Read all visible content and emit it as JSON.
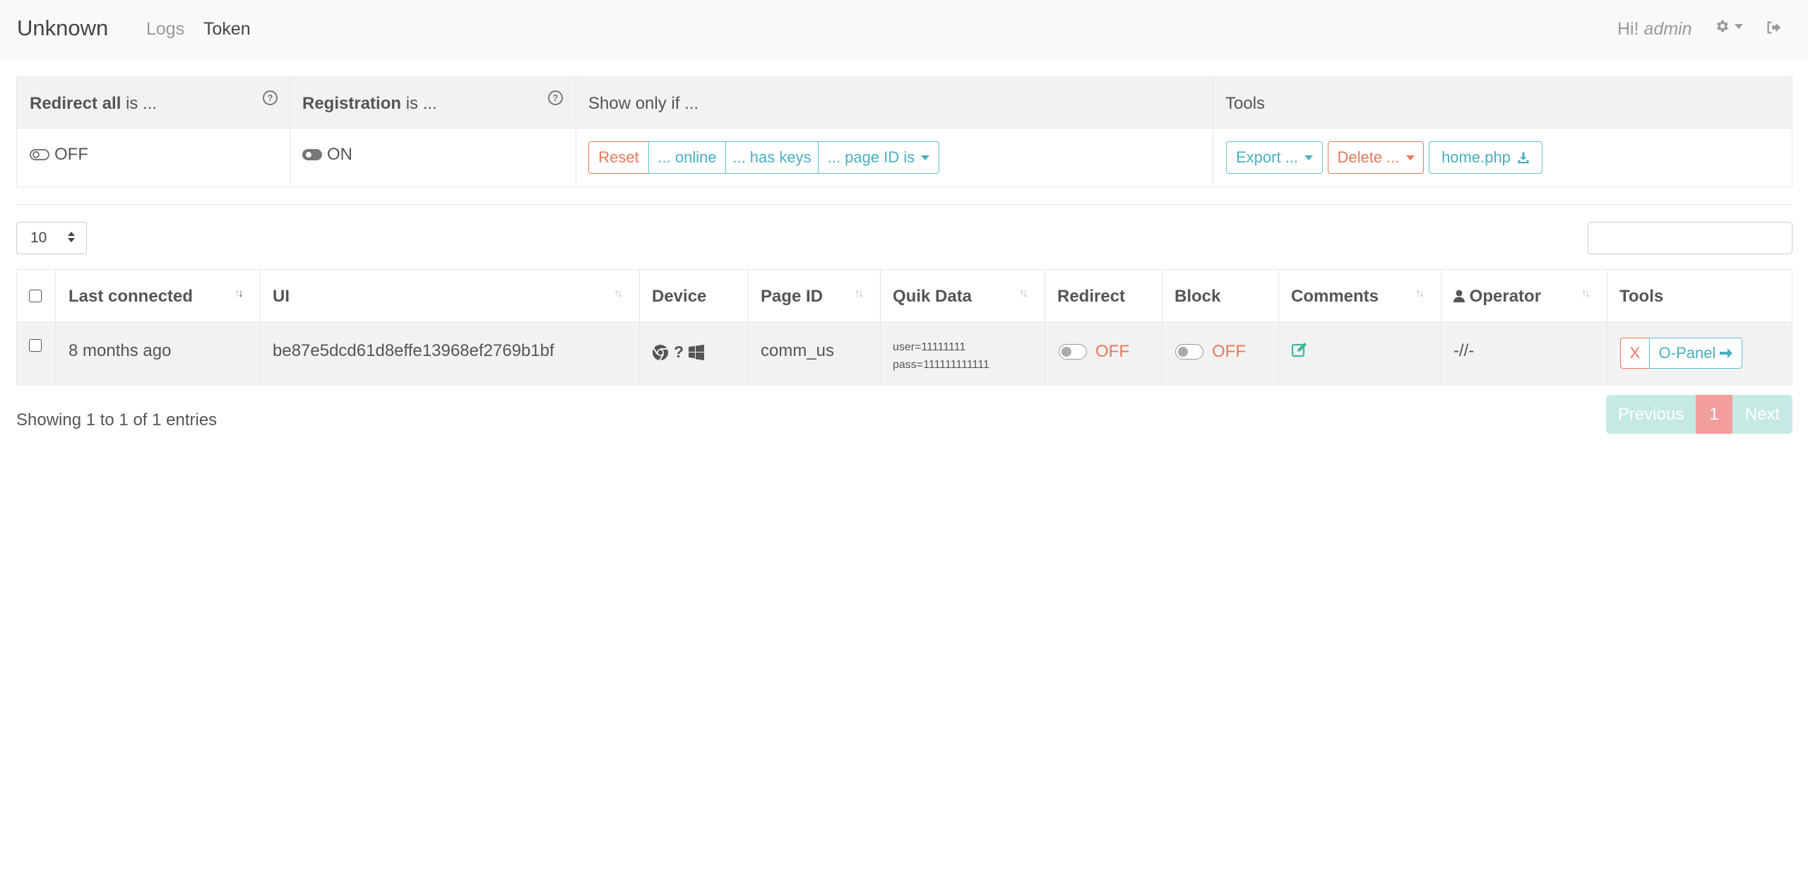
{
  "navbar": {
    "brand": "Unknown",
    "links": [
      "Logs",
      "Token"
    ],
    "greeting_prefix": "Hi!",
    "greeting_user": "admin"
  },
  "controls": {
    "headers": {
      "redirect_all_bold": "Redirect all",
      "redirect_all_rest": "is ...",
      "registration_bold": "Registration",
      "registration_rest": "is ...",
      "show_only": "Show only if ...",
      "tools": "Tools"
    },
    "redirect_all_state": "OFF",
    "registration_state": "ON",
    "filters": {
      "reset": "Reset",
      "online": "... online",
      "has_keys": "... has keys",
      "page_id": "... page ID is"
    },
    "tools": {
      "export": "Export ...",
      "delete": "Delete ...",
      "home": "home.php"
    }
  },
  "table": {
    "page_length": "10",
    "columns": {
      "last_connected": "Last connected",
      "ui": "UI",
      "device": "Device",
      "page_id": "Page ID",
      "quik_data": "Quik Data",
      "redirect": "Redirect",
      "block": "Block",
      "comments": "Comments",
      "operator": "Operator",
      "tools": "Tools"
    },
    "rows": [
      {
        "last_connected": "8 months ago",
        "ui": "be87e5dcd61d8effe13968ef2769b1bf",
        "device_icons": [
          "chrome-icon",
          "question-icon",
          "windows-icon"
        ],
        "device_question": "?",
        "page_id": "comm_us",
        "quik_user": "user=11111111",
        "quik_pass": "pass=111111111111",
        "redirect": "OFF",
        "block": "OFF",
        "operator": "-//-",
        "tool_x": "X",
        "tool_panel": "O-Panel"
      }
    ],
    "info": "Showing 1 to 1 of 1 entries",
    "pagination": {
      "previous": "Previous",
      "current": "1",
      "next": "Next"
    }
  },
  "colors": {
    "accent_info": "#4aafc0",
    "accent_danger": "#e8785c",
    "page_active": "#f29e9e",
    "page_disabled": "#c5eae4"
  }
}
